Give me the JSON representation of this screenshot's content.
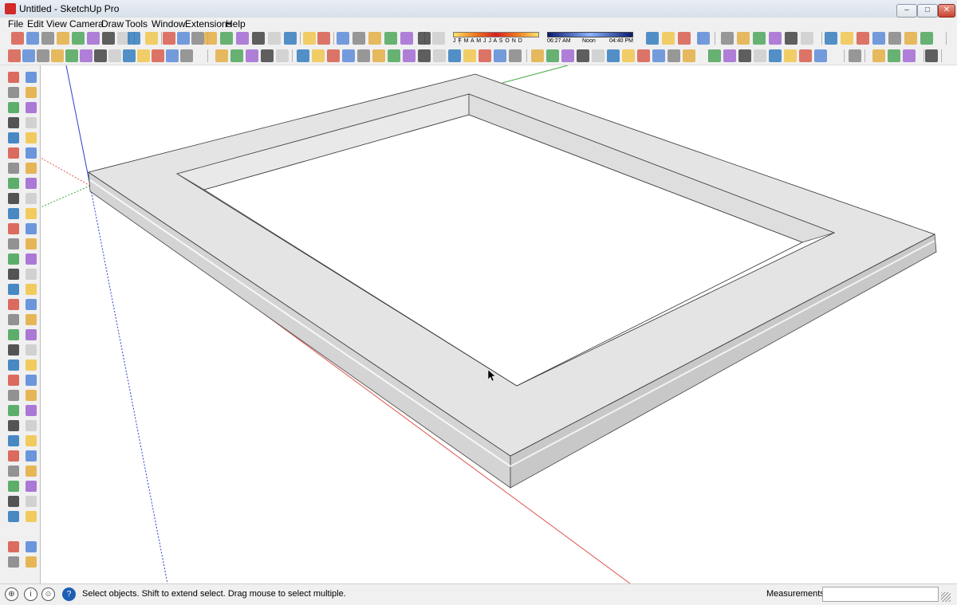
{
  "window": {
    "title": "Untitled - SketchUp Pro"
  },
  "menu": [
    "File",
    "Edit",
    "View",
    "Camera",
    "Draw",
    "Tools",
    "Window",
    "Extensions",
    "Help"
  ],
  "shadow": {
    "months": "J F M A M J J A S O N D",
    "time_start": "06:27 AM",
    "time_noon": "Noon",
    "time_end": "04:40 PM"
  },
  "status": {
    "hint": "Select objects. Shift to extend select. Drag mouse to select multiple.",
    "measurements_label": "Measurements",
    "measurements_value": ""
  },
  "colors": {
    "accent_red": "#d02a2a",
    "axis_red": "#e0564a",
    "axis_green": "#3aa83a",
    "axis_blue": "#2b3fcf",
    "chrome": "#f0f0f0"
  },
  "icons": [
    "select-icon",
    "eraser-icon",
    "paint-bucket-icon",
    "line-icon",
    "rectangle-icon",
    "circle-icon",
    "arc-icon",
    "move-icon",
    "rotate-icon",
    "scale-icon",
    "push-pull-icon",
    "offset-icon",
    "tape-measure-icon",
    "orbit-icon",
    "pan-icon",
    "zoom-icon",
    "zoom-extents-icon",
    "section-plane-icon"
  ]
}
